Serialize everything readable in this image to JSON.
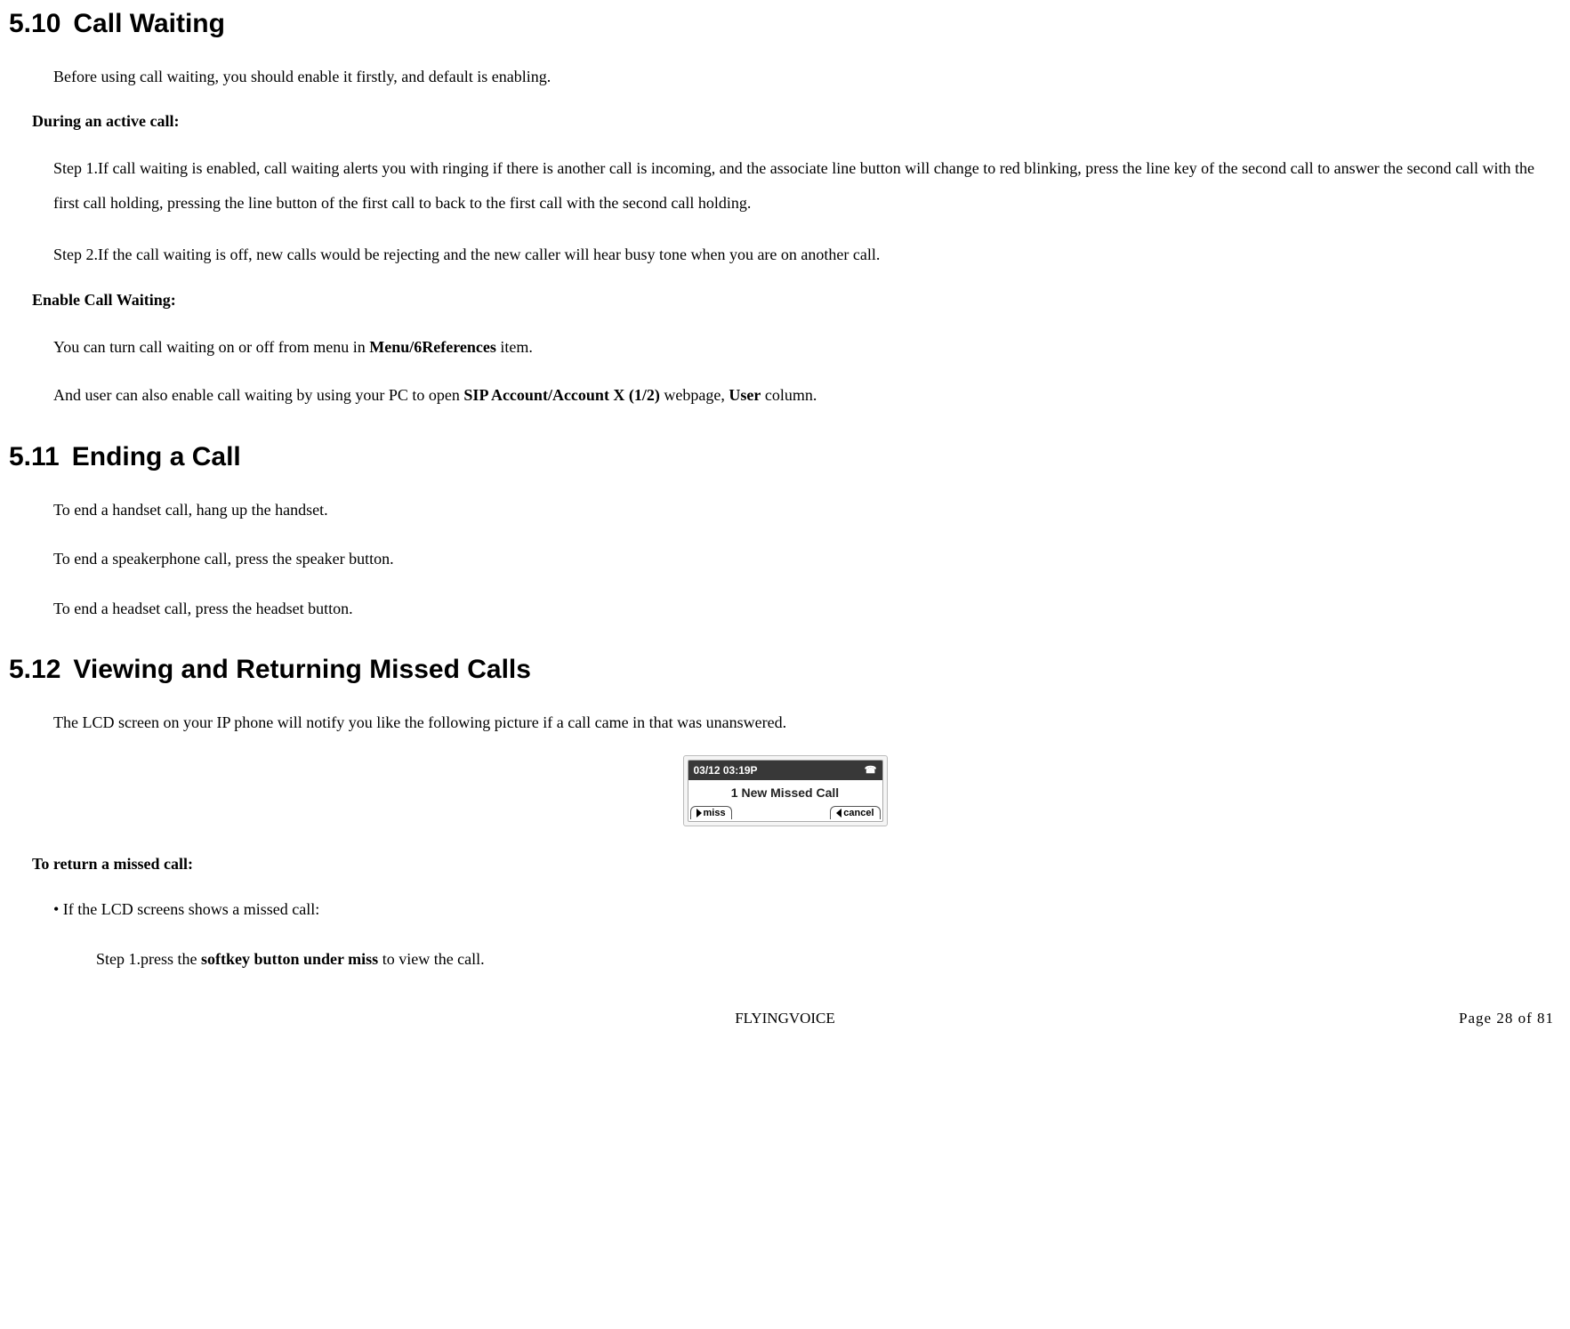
{
  "section_5_10": {
    "number": "5.10",
    "title": "Call Waiting",
    "intro": "Before using call waiting, you should enable it firstly, and default is enabling.",
    "during_call_label": "During an active call:",
    "step1": "Step 1.If call waiting is enabled, call waiting alerts you with ringing if there is another call is incoming, and the associate line button will change to red blinking, press the line key of the second call to answer the second call with the first call holding, pressing the line button of the first call to back to the first call with the second call holding.",
    "step2": "Step 2.If the call waiting is off, new calls would be rejecting and the new caller will hear busy tone when you are on another call.",
    "enable_label": "Enable Call Waiting:",
    "enable_line1_pre": "You can turn call waiting on or off from menu in ",
    "enable_line1_bold": "Menu/6References",
    "enable_line1_post": " item.",
    "enable_line2_pre": "And user can also enable call waiting by using your PC to open ",
    "enable_line2_bold1": "SIP Account/Account X (1/2)",
    "enable_line2_mid": " webpage, ",
    "enable_line2_bold2": "User",
    "enable_line2_post": " column."
  },
  "section_5_11": {
    "number": "5.11",
    "title": "Ending a Call",
    "line1": "To end a handset call, hang up the handset.",
    "line2": "To end a speakerphone call, press the speaker button.",
    "line3": "To end a headset call, press the headset button."
  },
  "section_5_12": {
    "number": "5.12",
    "title": "Viewing and Returning Missed Calls",
    "intro": "The LCD screen on your IP phone will notify you like the following picture if a call came in that was unanswered.",
    "lcd": {
      "time": "03/12 03:19P",
      "message": "1 New Missed Call",
      "soft_left": "miss",
      "soft_right": "cancel"
    },
    "return_label": "To return a missed call:",
    "bullet1": "• If the LCD screens shows a missed call:",
    "step1_pre": "Step 1.press the ",
    "step1_bold": "softkey button under miss",
    "step1_post": " to view the call."
  },
  "footer": {
    "brand": "FLYINGVOICE",
    "page_label": "Page  28  of  81"
  }
}
